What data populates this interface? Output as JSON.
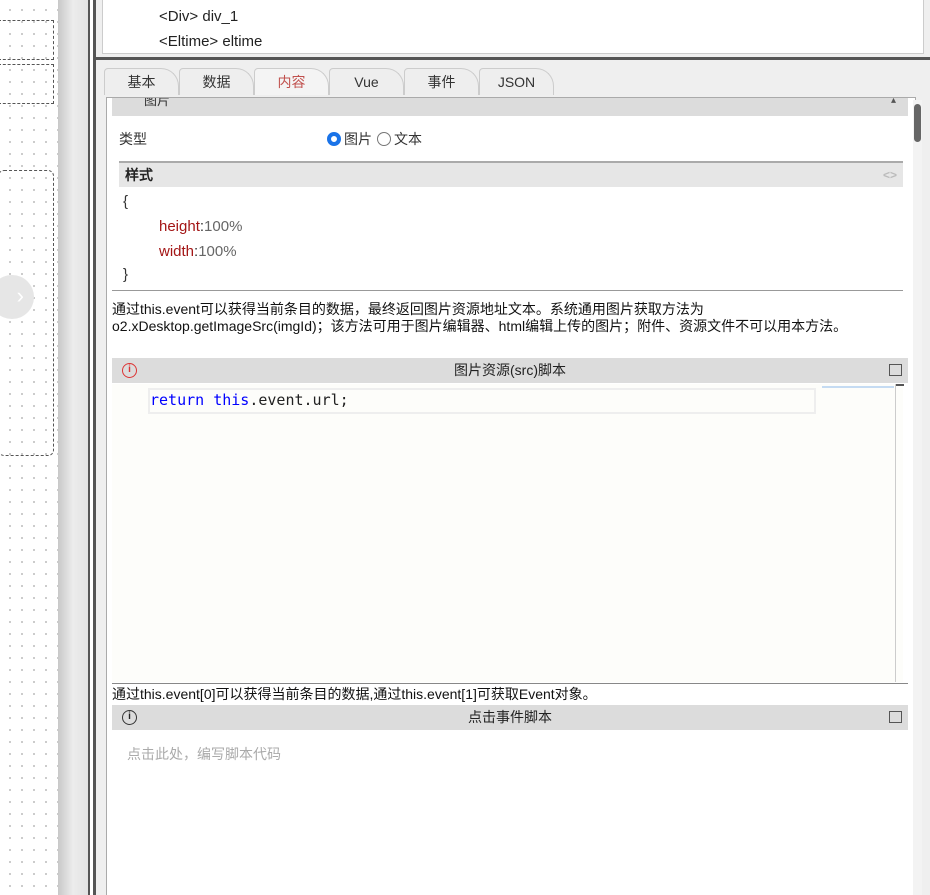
{
  "tree": {
    "items": [
      "<Div> div_1",
      "<Eltime> eltime"
    ]
  },
  "tabs": [
    {
      "label": "基本"
    },
    {
      "label": "数据"
    },
    {
      "label": "内容"
    },
    {
      "label": "Vue"
    },
    {
      "label": "事件"
    },
    {
      "label": "JSON"
    }
  ],
  "section": {
    "title": "图片"
  },
  "type": {
    "label": "类型",
    "options": [
      "图片",
      "文本"
    ],
    "selected": "图片"
  },
  "style": {
    "title": "样式",
    "open": "{",
    "close": "}",
    "props": [
      {
        "key": "height",
        "value": "100%"
      },
      {
        "key": "width",
        "value": "100%"
      }
    ]
  },
  "src_desc": "通过this.event可以获得当前条目的数据，最终返回图片资源地址文本。系统通用图片获取方法为o2.xDesktop.getImageSrc(imgId)；该方法可用于图片编辑器、html编辑上传的图片；附件、资源文件不可以用本方法。",
  "src_panel": {
    "title": "图片资源(src)脚本",
    "code_kw1": "return",
    "code_kw2": "this",
    "code_rest": ".event.url;"
  },
  "click_desc": "通过this.event[0]可以获得当前条目的数据,通过this.event[1]可获取Event对象。",
  "click_panel": {
    "title": "点击事件脚本",
    "placeholder": "点击此处，编写脚本代码"
  }
}
